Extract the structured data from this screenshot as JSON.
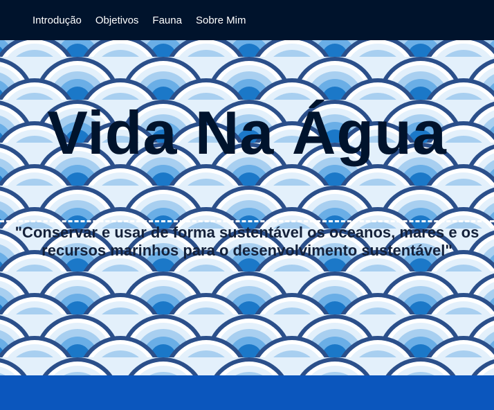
{
  "nav": {
    "items": [
      {
        "label": "Introdução"
      },
      {
        "label": "Objetivos"
      },
      {
        "label": "Fauna"
      },
      {
        "label": "Sobre Mim"
      }
    ]
  },
  "hero": {
    "title": "Vida Na Água",
    "quote": "\"Conservar e usar de forma sustentável os oceanos, mares e os recursos marinhos para o desenvolvimento sustentável\""
  },
  "colors": {
    "nav_bg": "#00132c",
    "footer_bg": "#0b56bd",
    "title": "#00132c",
    "scale_outline": "#2b4f8a",
    "scale_rings": [
      "#ffffff",
      "#e3f0fb",
      "#a8cff0",
      "#6aaee6",
      "#1b78c8"
    ]
  }
}
